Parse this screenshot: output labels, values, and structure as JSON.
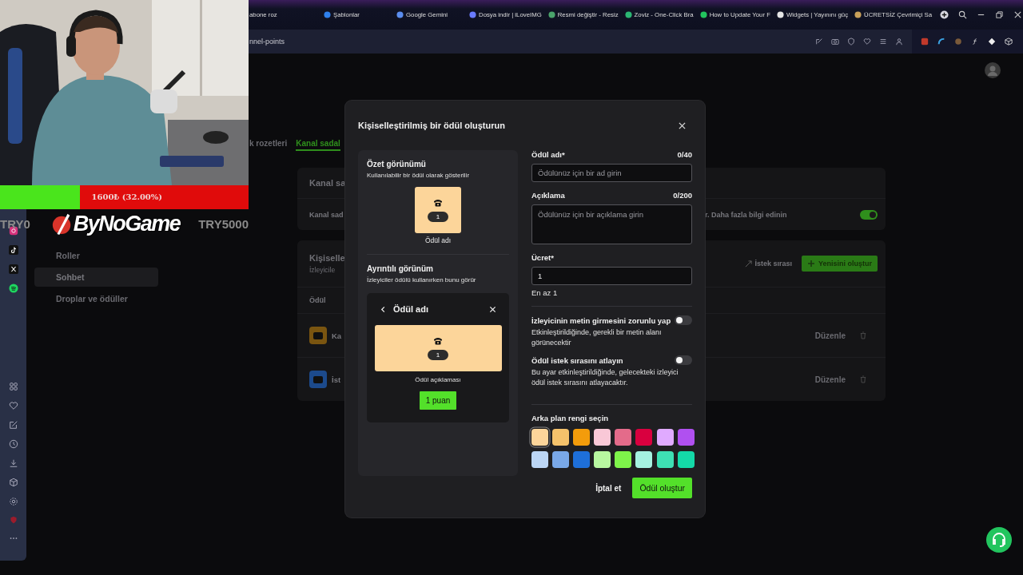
{
  "donation_goal": {
    "label": "1600₺ (32.00%)",
    "level": 0.32,
    "min": "TRY0",
    "max": "TRY5000",
    "logo": "ByNoGame"
  },
  "browser": {
    "tabs": [
      {
        "label": "abone roz"
      },
      {
        "label": "Şablonlar",
        "color": "#2f80ed"
      },
      {
        "label": "Google Gemini",
        "color": "#5b8def"
      },
      {
        "label": "Dosya indir | iLoveIMG",
        "color": "#6a7bff"
      },
      {
        "label": "Resmi değiştir - Resiz",
        "color": "#4aa36b"
      },
      {
        "label": "Zoviz - One-Click Bra",
        "color": "#2bb673"
      },
      {
        "label": "How to Update Your F",
        "color": "#22c55e"
      },
      {
        "label": "Widgets | Yayınını güç",
        "color": "#e5e5e5"
      },
      {
        "label": "ÜCRETSİZ Çevrimiçi Sa",
        "color": "#c8a05a"
      }
    ],
    "address": "nnel-points"
  },
  "page": {
    "tabs": [
      {
        "label": "k rozetleri",
        "selected": false
      },
      {
        "label": "Kanal sadal",
        "selected": true
      }
    ],
    "nav": [
      {
        "label": "Roller",
        "selected": false
      },
      {
        "label": "Sohbet",
        "selected": true
      },
      {
        "label": "Droplar ve ödüller",
        "selected": false
      }
    ],
    "settings_card": {
      "title": "Kanal sa",
      "text_left": "Kanal sad",
      "text_right": "r. Daha fazla bilgi edinin",
      "on": true
    },
    "rewards_card": {
      "title": "Kişiselle",
      "subtitle": "İzleyicile",
      "queue_button": "İstek sırası",
      "create_button": "Yenisini oluştur",
      "column": "Ödül",
      "rows": [
        {
          "name": "Ka",
          "color": "#7a5510",
          "action": "Düzenle"
        },
        {
          "name": "İst",
          "color": "#1c4a8c",
          "action": "Düzenle"
        }
      ]
    }
  },
  "modal": {
    "title": "Kişiselleştirilmiş bir ödül oluşturun",
    "summary": {
      "title": "Özet görünümü",
      "subtitle": "Kullanılabilir bir ödül olarak gösterilir",
      "cost": "1",
      "name": "Ödül adı"
    },
    "detail": {
      "title": "Ayrıntılı görünüm",
      "subtitle": "İzleyiciler ödülü kullanırken bunu görür",
      "name": "Ödül adı",
      "cost": "1",
      "description": "Ödül açıklaması",
      "button": "1 puan"
    },
    "name_field": {
      "label": "Ödül adı*",
      "count": "0/40",
      "placeholder": "Ödülünüz için bir ad girin"
    },
    "description_field": {
      "label": "Açıklama",
      "count": "0/200",
      "placeholder": "Ödülünüz için bir açıklama girin"
    },
    "cost_field": {
      "label": "Ücret*",
      "value": "1",
      "hint": "En az 1"
    },
    "toggles": [
      {
        "label": "İzleyicinin metin girmesini zorunlu yap",
        "description": "Etkinleştirildiğinde, gerekli bir metin alanı görünecektir",
        "on": false
      },
      {
        "label": "Ödül istek sırasını atlayın",
        "description": "Bu ayar etkinleştirildiğinde, gelecekteki izleyici ödül istek sırasını atlayacaktır.",
        "on": false
      }
    ],
    "color_label": "Arka plan rengi seçin",
    "colors": [
      {
        "color": "#fcd59a",
        "selected": true
      },
      {
        "color": "#f5c26b",
        "selected": false
      },
      {
        "color": "#f39c0b",
        "selected": false
      },
      {
        "color": "#f9c8d7",
        "selected": false
      },
      {
        "color": "#e46b8a",
        "selected": false
      },
      {
        "color": "#d9003f",
        "selected": false
      },
      {
        "color": "#e0aaff",
        "selected": false
      },
      {
        "color": "#b050f0",
        "selected": false
      },
      {
        "color": "#bcd6f5",
        "selected": false
      },
      {
        "color": "#79a8e8",
        "selected": false
      },
      {
        "color": "#1e6fd9",
        "selected": false
      },
      {
        "color": "#b8f7a0",
        "selected": false
      },
      {
        "color": "#7ef44a",
        "selected": false
      },
      {
        "color": "#a5f2e1",
        "selected": false
      },
      {
        "color": "#3ee0b4",
        "selected": false
      },
      {
        "color": "#14d9a8",
        "selected": false
      }
    ],
    "cancel": "İptal et",
    "submit": "Ödül oluştur"
  }
}
